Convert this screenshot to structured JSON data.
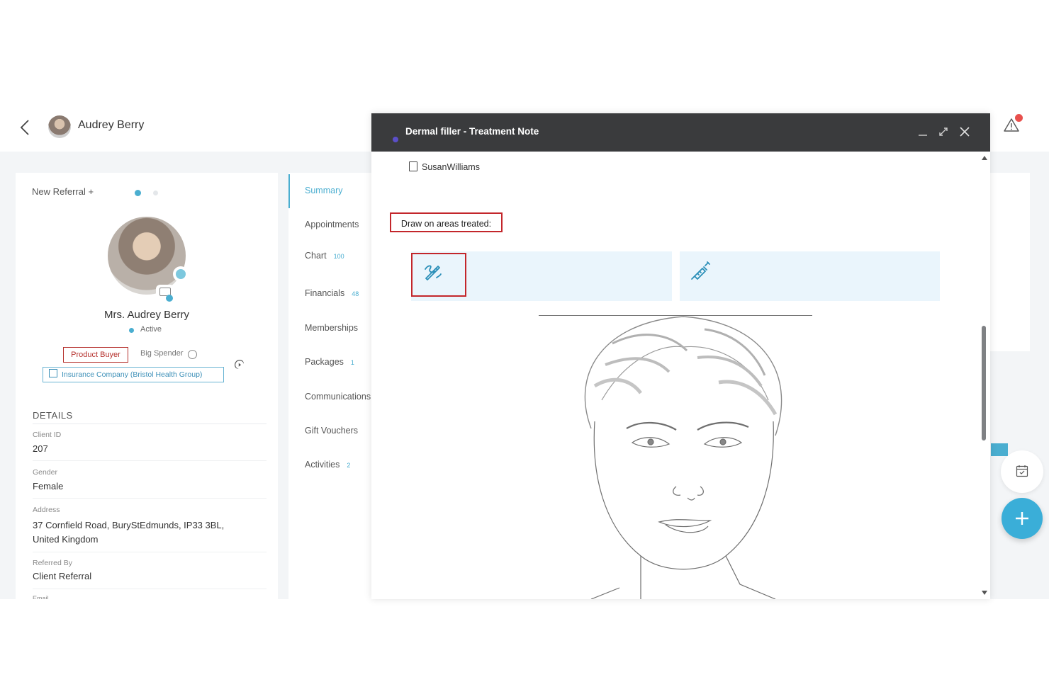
{
  "header": {
    "client_name": "Audrey Berry"
  },
  "profile": {
    "new_referral": "New Referral +",
    "full_name": "Mrs. Audrey Berry",
    "status": "Active",
    "tags": {
      "product_buyer": "Product Buyer",
      "big_spender": "Big Spender"
    },
    "insurance": "Insurance Company (Bristol Health Group)",
    "details_heading": "DETAILS",
    "details": {
      "client_id_label": "Client ID",
      "client_id": "207",
      "gender_label": "Gender",
      "gender": "Female",
      "address_label": "Address",
      "address_line1": "37 Cornfield Road, BuryStEdmunds, IP33 3BL,",
      "address_line2": "United Kingdom",
      "referred_by_label": "Referred By",
      "referred_by": "Client Referral",
      "email_label": "Email"
    }
  },
  "nav": {
    "summary": "Summary",
    "appointments": "Appointments",
    "chart": "Chart",
    "chart_count": "100",
    "financials": "Financials",
    "financials_count": "48",
    "memberships": "Memberships",
    "packages": "Packages",
    "packages_count": "1",
    "communications": "Communications",
    "gift_vouchers": "Gift Vouchers",
    "activities": "Activities",
    "activities_count": "2"
  },
  "modal": {
    "title": "Dermal filler - Treatment Note",
    "author": "SusanWilliams",
    "draw_label": "Draw on areas treated:",
    "tools": [
      "pencil-icon",
      "syringe-icon"
    ]
  },
  "colors": {
    "accent": "#4aaed0",
    "modal_header": "#3a3b3d",
    "highlight_red": "#c3262b",
    "tool_bg": "#eaf5fc",
    "fab": "#3aaed8"
  }
}
